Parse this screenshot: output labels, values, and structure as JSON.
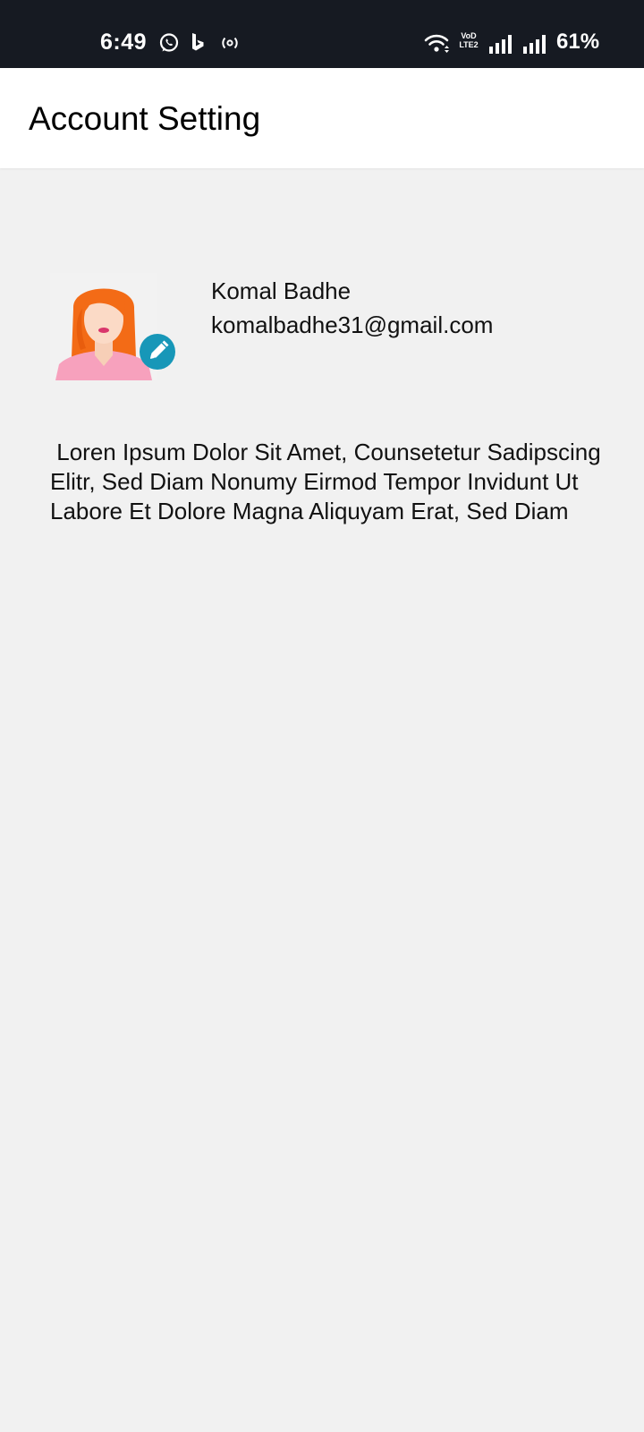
{
  "status_bar": {
    "time": "6:49",
    "battery": "61%",
    "volte_top": "VoD",
    "volte_bottom": "LTE2",
    "icons": [
      "whatsapp-icon",
      "bing-icon",
      "hotspot-icon",
      "wifi-icon",
      "volte-icon",
      "signal-icon",
      "signal-icon"
    ]
  },
  "app_bar": {
    "title": "Account Setting"
  },
  "profile": {
    "name": "Komal Badhe",
    "email": "komalbadhe31@gmail.com",
    "avatar_icon": "female-avatar",
    "edit_icon": "pencil-icon",
    "edit_badge_color": "#1797b8"
  },
  "bio": " Loren Ipsum Dolor Sit Amet, Counsetetur Sadipscing Elitr, Sed Diam Nonumy Eirmod Tempor Invidunt Ut Labore Et Dolore Magna Aliquyam Erat, Sed Diam",
  "colors": {
    "status_bar_bg": "#161a22",
    "app_bar_bg": "#ffffff",
    "page_bg": "#f1f1f1"
  }
}
